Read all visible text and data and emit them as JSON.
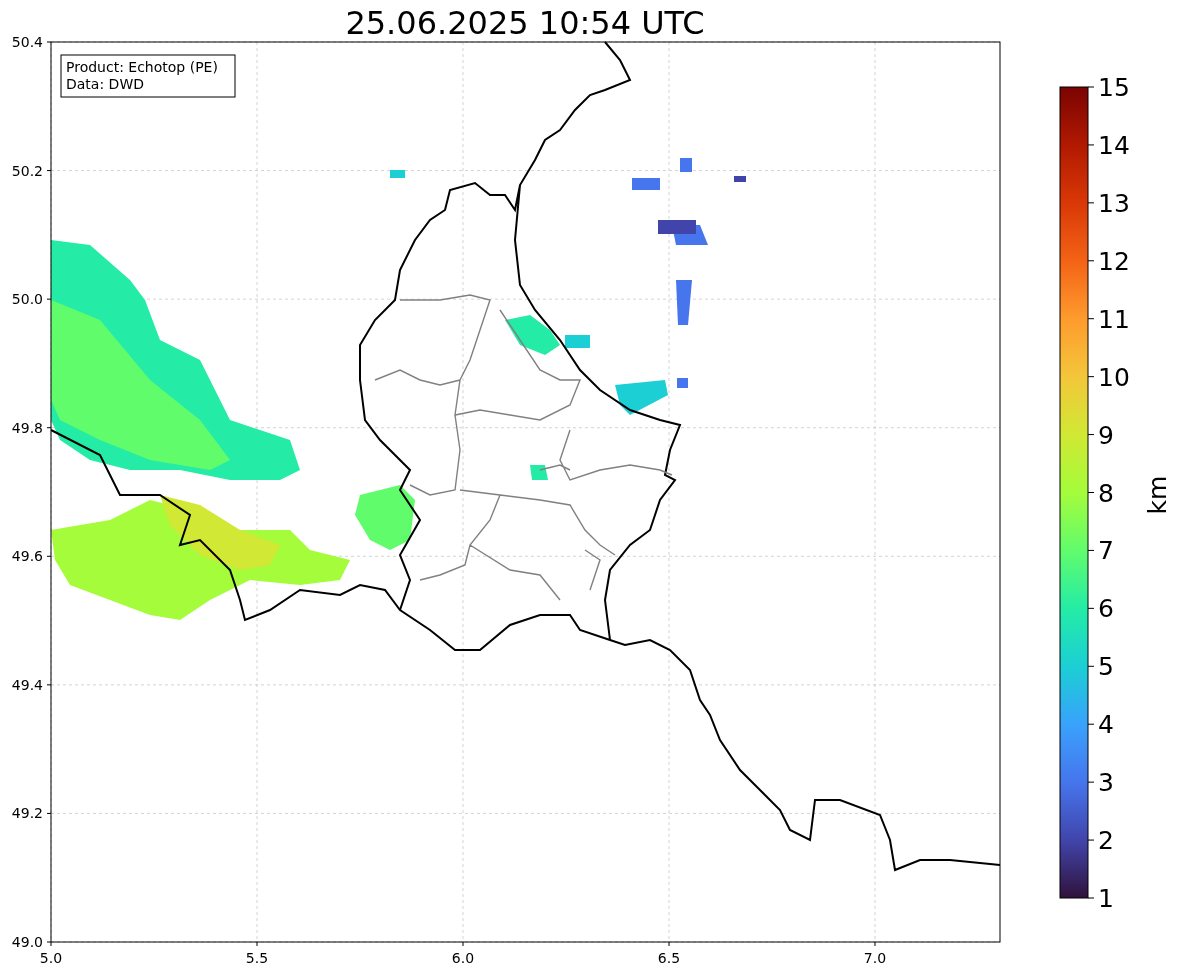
{
  "title": "25.06.2025 10:54 UTC",
  "legend": [
    "Product: Echotop (PE)",
    "Data: DWD"
  ],
  "x_axis": {
    "ticks": [
      "5.0",
      "5.5",
      "6.0",
      "6.5",
      "7.0"
    ]
  },
  "y_axis": {
    "ticks": [
      "50.4",
      "50.2",
      "50.0",
      "49.8",
      "49.6",
      "49.4",
      "49.2",
      "49.0"
    ]
  },
  "colorbar": {
    "label": "km",
    "ticks": [
      "15",
      "14",
      "13",
      "12",
      "11",
      "10",
      "9",
      "8",
      "7",
      "6",
      "5",
      "4",
      "3",
      "2",
      "1"
    ]
  }
}
